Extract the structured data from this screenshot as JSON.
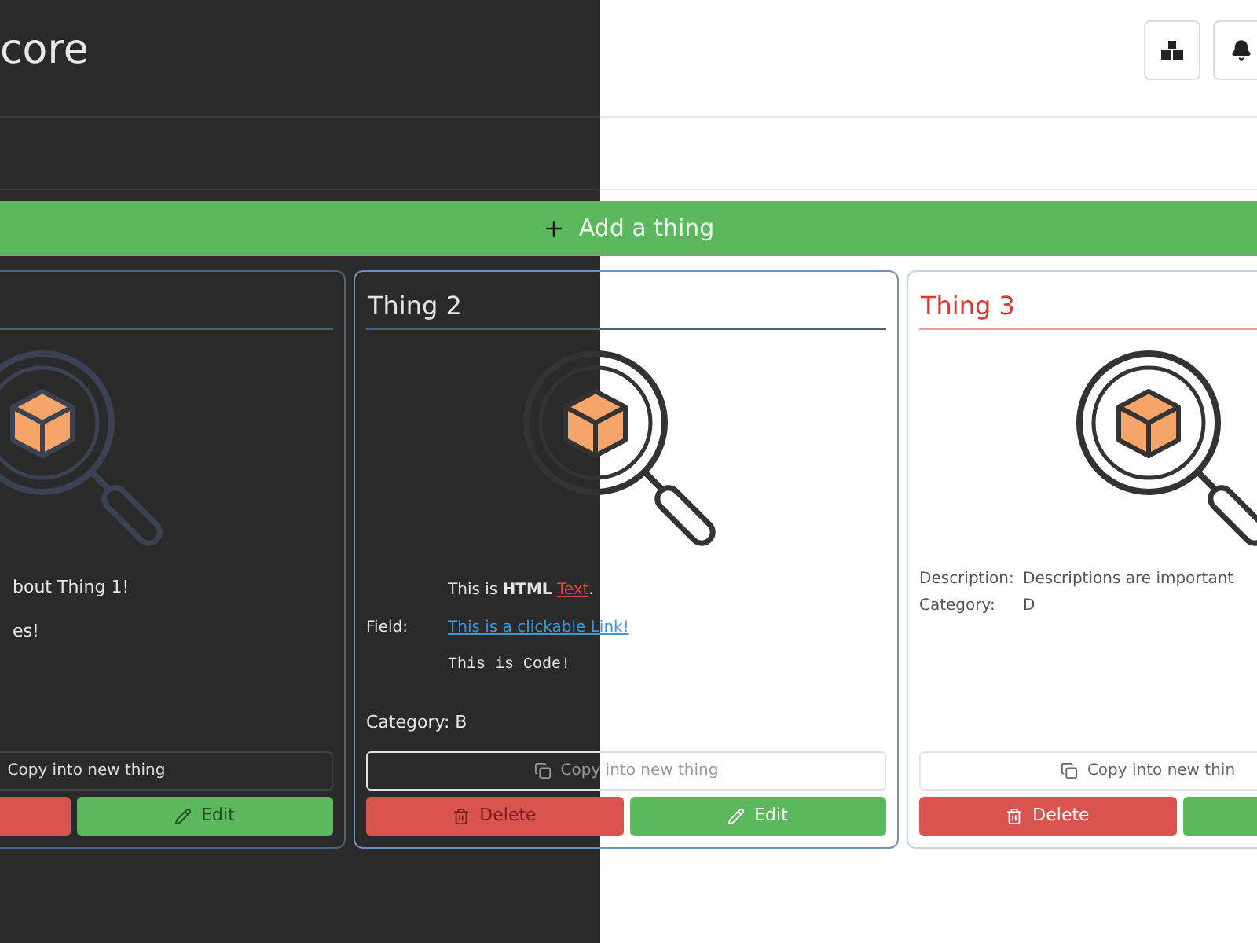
{
  "header": {
    "title": "core"
  },
  "add_button": {
    "label": "Add a thing"
  },
  "cards": [
    {
      "alert": false,
      "fields": [
        {
          "kind": "text",
          "value": "bout Thing 1!"
        },
        {
          "kind": "text",
          "value": "es!"
        }
      ],
      "copy_label": "Copy into new thing",
      "edit_label": "Edit"
    },
    {
      "title": "Thing 2",
      "alert": false,
      "fields": [
        {
          "kind": "html",
          "label": "Field:",
          "lines": [
            {
              "kind": "rich",
              "text": "This is **HTML** ",
              "accent": "Text",
              "tail": "."
            },
            {
              "kind": "link",
              "text": "This is a clickable Link!"
            },
            {
              "kind": "code",
              "text": "This is Code!"
            }
          ]
        },
        {
          "kind": "inline",
          "label": "Category:",
          "value": "B"
        }
      ],
      "copy_label": "Copy into new thing",
      "delete_label": "Delete",
      "edit_label": "Edit"
    },
    {
      "title": "Thing 3",
      "alert": true,
      "fields": [
        {
          "kind": "pair",
          "label": "Description:",
          "value": "Descriptions are important"
        },
        {
          "kind": "pair",
          "label": "Category:",
          "value": "D"
        }
      ],
      "copy_label": "Copy into new thin",
      "delete_label": "Delete"
    }
  ]
}
